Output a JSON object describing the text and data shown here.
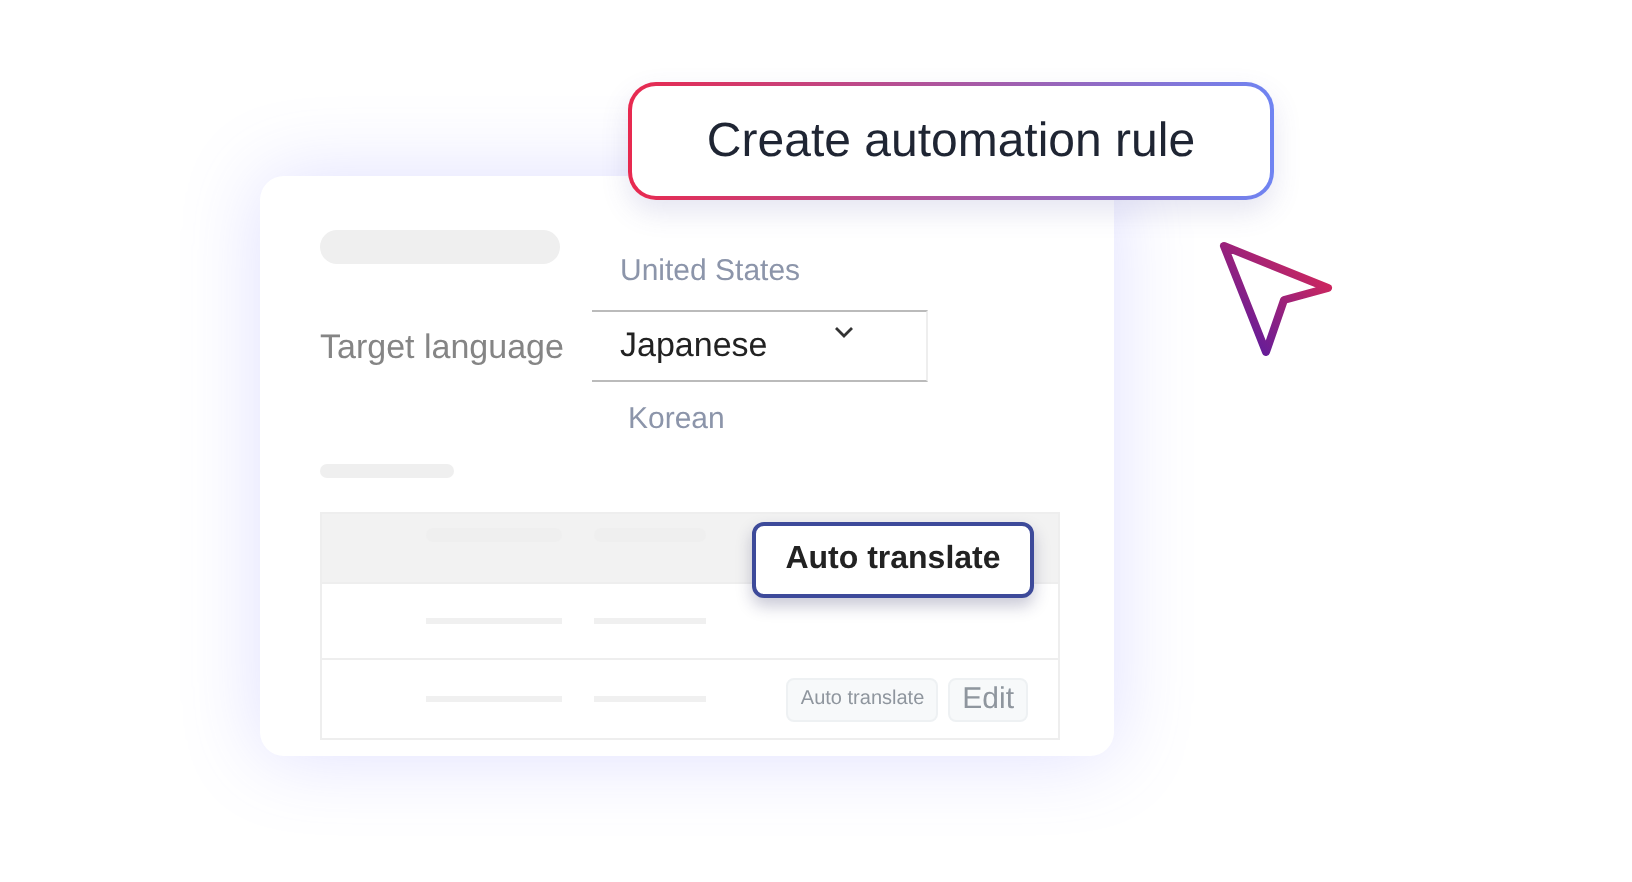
{
  "automation_button": {
    "label": "Create automation rule"
  },
  "form": {
    "label": "Target language",
    "options": [
      {
        "label": "United States",
        "selected": false
      },
      {
        "label": "Japanese",
        "selected": true
      },
      {
        "label": "Korean",
        "selected": false
      }
    ]
  },
  "table": {
    "rows": [
      {
        "actions": []
      },
      {
        "actions": [
          {
            "label": "Auto translate",
            "disabled": true
          },
          {
            "label": "Edit",
            "disabled": true
          }
        ]
      }
    ]
  },
  "floating_button": {
    "label": "Auto translate"
  }
}
